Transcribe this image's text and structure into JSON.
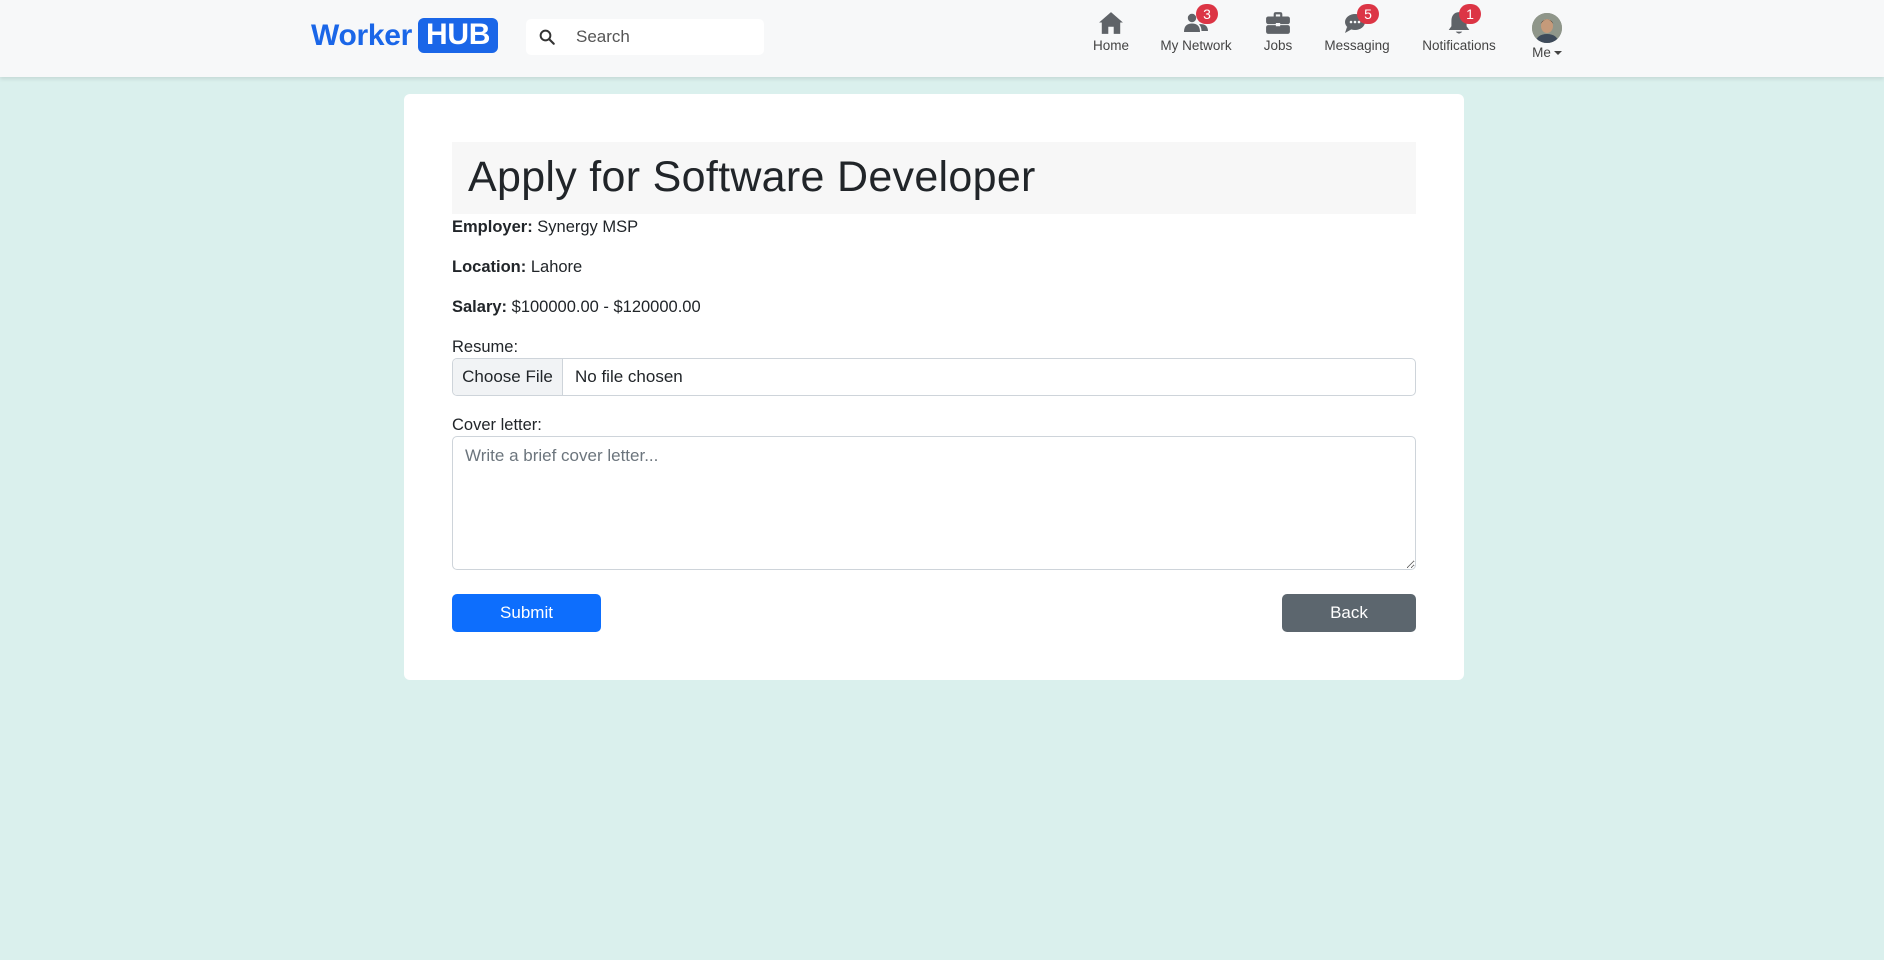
{
  "colors": {
    "background": "#daf0ed",
    "brand": "#1a66e8",
    "badge": "#dc3545",
    "submit": "#0d6efd",
    "back": "#5c666e"
  },
  "navbar": {
    "brand": {
      "word": "Worker",
      "badge": "HUB"
    },
    "search": {
      "placeholder": "Search",
      "icon": "search-icon"
    },
    "items": [
      {
        "label": "Home",
        "icon": "home-icon",
        "badge": ""
      },
      {
        "label": "My Network",
        "icon": "network-icon",
        "badge": "3"
      },
      {
        "label": "Jobs",
        "icon": "briefcase-icon",
        "badge": ""
      },
      {
        "label": "Messaging",
        "icon": "messaging-icon",
        "badge": "5"
      },
      {
        "label": "Notifications",
        "icon": "bell-icon",
        "badge": "1"
      }
    ],
    "me": {
      "label": "Me",
      "icon": "avatar"
    }
  },
  "form": {
    "title": "Apply for Software Developer",
    "employer": {
      "label": "Employer:",
      "value": "Synergy MSP"
    },
    "location": {
      "label": "Location:",
      "value": "Lahore"
    },
    "salary": {
      "label": "Salary:",
      "value": "$100000.00 - $120000.00"
    },
    "resume": {
      "label": "Resume:",
      "button": "Choose File",
      "status": "No file chosen"
    },
    "cover_letter": {
      "label": "Cover letter:",
      "placeholder": "Write a brief cover letter...",
      "value": ""
    },
    "submit_label": "Submit",
    "back_label": "Back"
  }
}
